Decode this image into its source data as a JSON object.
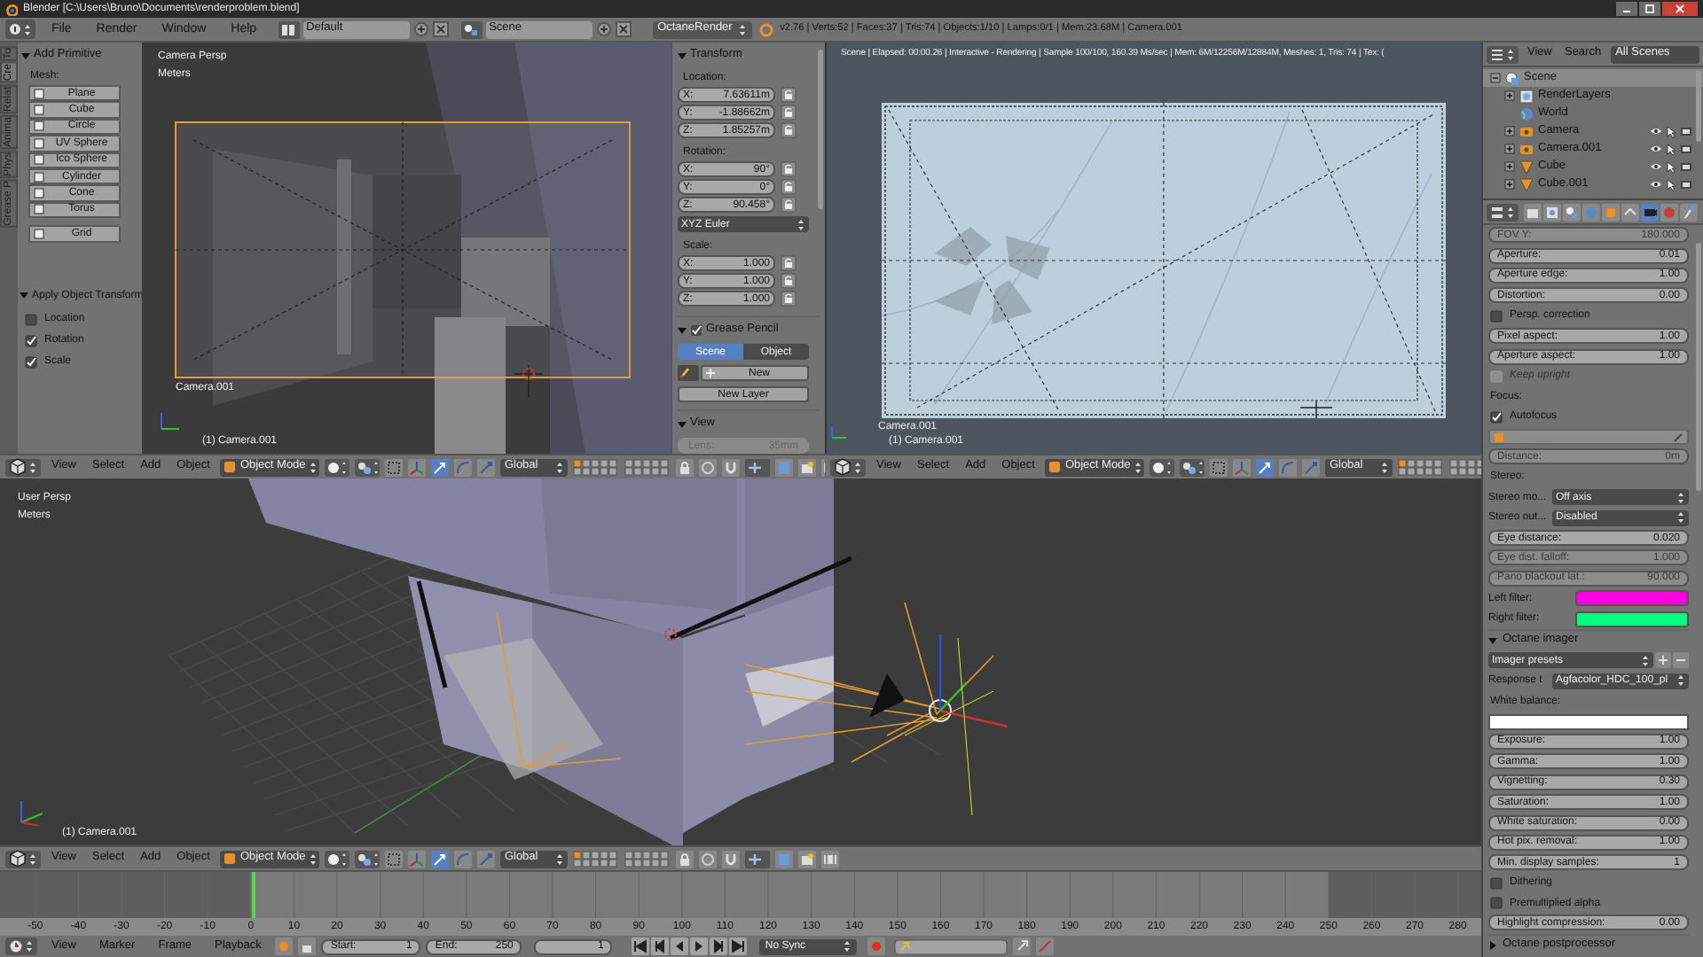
{
  "title_bar": {
    "title": "Blender [C:\\Users\\Bruno\\Documents\\renderproblem.blend]"
  },
  "info_header": {
    "menus": [
      "File",
      "Render",
      "Window",
      "Help"
    ],
    "layout": "Default",
    "scene": "Scene",
    "engine": "OctaneRender",
    "stats": "v2.76 | Verts:52 | Faces:37 | Tris:74 | Objects:1/10 | Lamps:0/1 | Mem:23.68M | Camera.001"
  },
  "tool_shelf": {
    "tabs": [
      {
        "label": "To",
        "selected": false
      },
      {
        "label": "Cre",
        "selected": true
      },
      {
        "label": "Relat",
        "selected": false
      },
      {
        "label": "Anima",
        "selected": false
      },
      {
        "label": "Phys",
        "selected": false
      },
      {
        "label": "Grease P",
        "selected": false
      }
    ],
    "add_primitive": {
      "title": "Add Primitive",
      "mesh_label": "Mesh:",
      "buttons": [
        "Plane",
        "Cube",
        "Circle",
        "UV Sphere",
        "Ico Sphere",
        "Cylinder",
        "Cone",
        "Torus",
        "Grid"
      ]
    },
    "apply_transform": {
      "title": "Apply Object Transform",
      "options": [
        {
          "label": "Location",
          "checked": false
        },
        {
          "label": "Rotation",
          "checked": true
        },
        {
          "label": "Scale",
          "checked": true
        }
      ]
    }
  },
  "camera_view": {
    "view_name": "Camera Persp",
    "units": "Meters",
    "camera_label": "Camera.001",
    "object_label": "(1) Camera.001"
  },
  "n_panel": {
    "transform_title": "Transform",
    "location_label": "Location:",
    "location": [
      {
        "axis": "X:",
        "value": "7.63611m"
      },
      {
        "axis": "Y:",
        "value": "-1.88662m"
      },
      {
        "axis": "Z:",
        "value": "1.85257m"
      }
    ],
    "rotation_label": "Rotation:",
    "rotation": [
      {
        "axis": "X:",
        "value": "90°"
      },
      {
        "axis": "Y:",
        "value": "0°"
      },
      {
        "axis": "Z:",
        "value": "90.458°"
      }
    ],
    "rotation_mode": "XYZ Euler",
    "scale_label": "Scale:",
    "scale": [
      {
        "axis": "X:",
        "value": "1.000"
      },
      {
        "axis": "Y:",
        "value": "1.000"
      },
      {
        "axis": "Z:",
        "value": "1.000"
      }
    ],
    "grease_pencil": {
      "title": "Grease Pencil",
      "checked": true,
      "tabs": [
        {
          "label": "Scene",
          "selected": true
        },
        {
          "label": "Object",
          "selected": false
        }
      ],
      "new": "New",
      "new_layer": "New Layer"
    },
    "view": {
      "title": "View",
      "lens_label": "Lens:",
      "lens": "35mm"
    }
  },
  "render_view": {
    "status": "Scene | Elapsed: 00:00.26 | Interactive - Rendering | Sample 100/100, 160.39 Ms/sec | Mem: 6M/12256M/12884M, Meshes: 1, Tris: 74 | Tex: (",
    "camera_label": "Camera.001",
    "object_label": "(1) Camera.001"
  },
  "viewport_headers": [
    {
      "menus": [
        "View",
        "Select",
        "Add",
        "Object"
      ],
      "mode": "Object Mode",
      "orientation": "Global"
    },
    {
      "menus": [
        "View",
        "Select",
        "Add",
        "Object"
      ],
      "mode": "Object Mode",
      "orientation": "Global"
    },
    {
      "menus": [
        "View",
        "Select",
        "Add",
        "Object"
      ],
      "mode": "Object Mode",
      "orientation": "Global"
    }
  ],
  "user_view": {
    "view_name": "User Persp",
    "units": "Meters",
    "object_label": "(1) Camera.001"
  },
  "timeline": {
    "ticks": [
      "-50",
      "-40",
      "-30",
      "-20",
      "-10",
      "0",
      "10",
      "20",
      "30",
      "40",
      "50",
      "60",
      "70",
      "80",
      "90",
      "100",
      "110",
      "120",
      "130",
      "140",
      "150",
      "160",
      "170",
      "180",
      "190",
      "200",
      "210",
      "220",
      "230",
      "240",
      "250",
      "260",
      "270",
      "280"
    ],
    "menus": [
      "View",
      "Marker",
      "Frame",
      "Playback"
    ],
    "start_label": "Start:",
    "start": "1",
    "end_label": "End:",
    "end": "250",
    "current": "1",
    "sync": "No Sync"
  },
  "outliner": {
    "menus": [
      "View",
      "Search"
    ],
    "filter": "All Scenes",
    "items": [
      {
        "label": "Scene",
        "kind": "scene",
        "expanded": true,
        "children": [
          {
            "label": "RenderLayers",
            "kind": "render_layers",
            "expanded": false
          },
          {
            "label": "World",
            "kind": "world"
          },
          {
            "label": "Camera",
            "kind": "camera",
            "expanded": false
          },
          {
            "label": "Camera.001",
            "kind": "camera",
            "expanded": false
          },
          {
            "label": "Cube",
            "kind": "mesh",
            "expanded": false
          },
          {
            "label": "Cube.001",
            "kind": "mesh",
            "expanded": false
          }
        ]
      }
    ]
  },
  "properties": {
    "context_tabs": [
      {
        "selected": false
      },
      {
        "selected": false
      },
      {
        "selected": false
      },
      {
        "selected": false
      },
      {
        "selected": false
      },
      {
        "selected": false
      },
      {
        "selected": true
      },
      {
        "selected": false
      },
      {
        "selected": false
      }
    ],
    "rows": [
      {
        "kind": "field",
        "label": "FOV Y:",
        "value": "180.000",
        "disabled": true
      },
      {
        "kind": "field",
        "label": "Aperture:",
        "value": "0.01",
        "disabled": false
      },
      {
        "kind": "field",
        "label": "Aperture edge:",
        "value": "1.00",
        "disabled": false
      },
      {
        "kind": "field",
        "label": "Distortion:",
        "value": "0.00",
        "disabled": false
      },
      {
        "kind": "checkbox",
        "label": "Persp. correction",
        "checked": false,
        "disabled": false
      },
      {
        "kind": "field",
        "label": "Pixel aspect:",
        "value": "1.00",
        "disabled": false
      },
      {
        "kind": "field",
        "label": "Aperture aspect:",
        "value": "1.00",
        "disabled": false
      },
      {
        "kind": "checkbox",
        "label": "Keep upright",
        "checked": false,
        "disabled": true
      },
      {
        "kind": "label",
        "label": "Focus:"
      },
      {
        "kind": "checkbox",
        "label": "Autofocus",
        "checked": true,
        "disabled": false
      },
      {
        "kind": "object"
      },
      {
        "kind": "field",
        "label": "Distance:",
        "value": "0m",
        "disabled": true
      },
      {
        "kind": "label",
        "label": "Stereo:"
      },
      {
        "kind": "dropdown",
        "label": "Stereo mo...",
        "value": "Off axis"
      },
      {
        "kind": "dropdown",
        "label": "Stereo out...",
        "value": "Disabled"
      },
      {
        "kind": "field",
        "label": "Eye distance:",
        "value": "0.020",
        "disabled": false
      },
      {
        "kind": "field",
        "label": "Eye dist. falloff:",
        "value": "1.000",
        "disabled": true
      },
      {
        "kind": "field",
        "label": "Pano blackout lat.:",
        "value": "90.000",
        "disabled": true
      },
      {
        "kind": "color",
        "label": "Left filter:",
        "color": "#ff00e0"
      },
      {
        "kind": "color",
        "label": "Right filter:",
        "color": "#00ff80"
      },
      {
        "kind": "panel",
        "label": "Octane imager",
        "expanded": true
      },
      {
        "kind": "preset",
        "label": "Imager presets"
      },
      {
        "kind": "dropdown",
        "label": "Response t",
        "value": "Agfacolor_HDC_100_pl"
      },
      {
        "kind": "label",
        "label": "White balance:"
      },
      {
        "kind": "swatch",
        "color": "#ffffff"
      },
      {
        "kind": "field",
        "label": "Exposure:",
        "value": "1.00",
        "disabled": false
      },
      {
        "kind": "field",
        "label": "Gamma:",
        "value": "1.00",
        "disabled": false
      },
      {
        "kind": "field",
        "label": "Vignetting:",
        "value": "0.30",
        "disabled": false
      },
      {
        "kind": "field",
        "label": "Saturation:",
        "value": "1.00",
        "disabled": false
      },
      {
        "kind": "field",
        "label": "White saturation:",
        "value": "0.00",
        "disabled": false
      },
      {
        "kind": "field",
        "label": "Hot pix. removal:",
        "value": "1.00",
        "disabled": false
      },
      {
        "kind": "field",
        "label": "Min. display samples:",
        "value": "1",
        "disabled": false
      },
      {
        "kind": "checkbox",
        "label": "Dithering",
        "checked": false,
        "disabled": false
      },
      {
        "kind": "checkbox",
        "label": "Premultiplied alpha",
        "checked": false,
        "disabled": false
      },
      {
        "kind": "field",
        "label": "Highlight compression:",
        "value": "0.00",
        "disabled": false
      },
      {
        "kind": "panel",
        "label": "Octane postprocessor",
        "expanded": false
      }
    ]
  }
}
